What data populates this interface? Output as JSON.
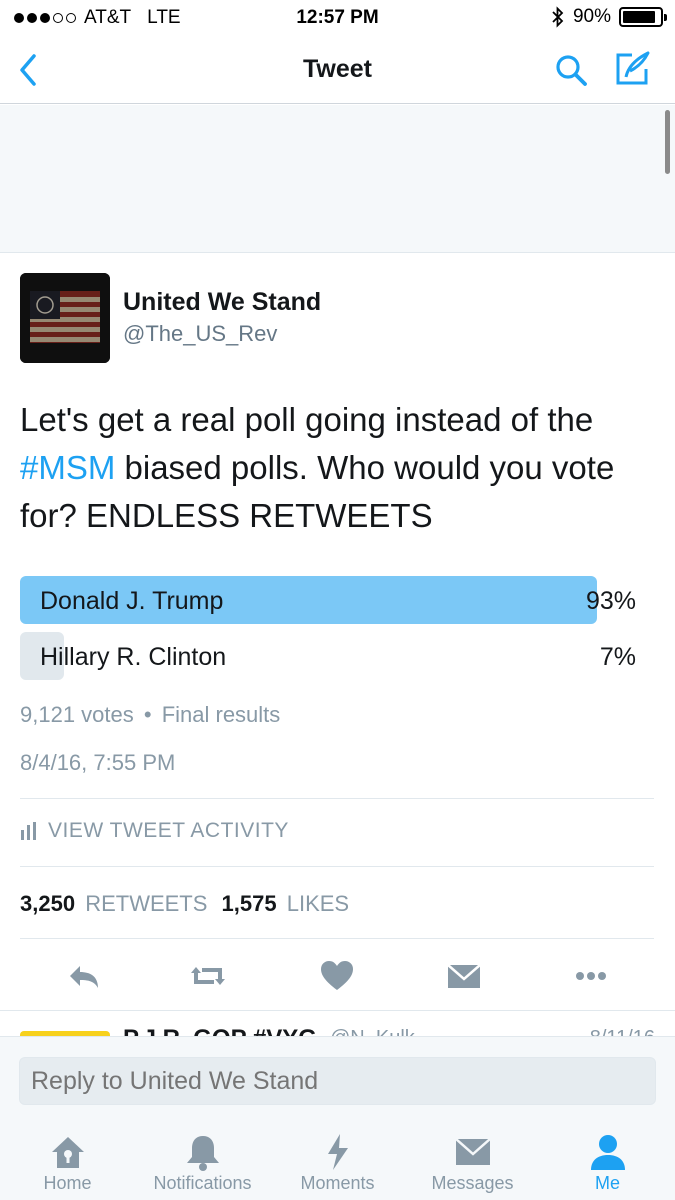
{
  "status_bar": {
    "carrier": "AT&T",
    "network": "LTE",
    "time": "12:57 PM",
    "battery_pct": "90%",
    "battery_level": 0.9
  },
  "nav": {
    "title": "Tweet",
    "back_icon": "chevron-left-icon",
    "search_icon": "search-icon",
    "compose_icon": "compose-icon"
  },
  "tweet": {
    "display_name": "United We Stand",
    "handle": "@The_US_Rev",
    "text_before": "Let's get a real poll going instead of the ",
    "hashtag": "#MSM",
    "text_after": " biased polls. Who would you vote for? ENDLESS RETWEETS",
    "timestamp": "8/4/16, 7:55 PM"
  },
  "poll": {
    "options": [
      {
        "label": "Donald J. Trump",
        "percent_label": "93%",
        "percent": 93,
        "leading": true
      },
      {
        "label": "Hillary R. Clinton",
        "percent_label": "7%",
        "percent": 7,
        "leading": false
      }
    ],
    "votes": "9,121 votes",
    "separator": "•",
    "status": "Final results"
  },
  "activity": {
    "label": "VIEW TWEET ACTIVITY"
  },
  "stats": {
    "retweets_count": "3,250",
    "retweets_label": "RETWEETS",
    "likes_count": "1,575",
    "likes_label": "LIKES"
  },
  "actions": [
    "reply-icon",
    "retweet-icon",
    "like-icon",
    "direct-message-icon",
    "more-icon"
  ],
  "next_tweet": {
    "name": "P.J.R. GOP #VYG",
    "handle": "@N_Kulk",
    "date": "8/11/16"
  },
  "reply": {
    "placeholder": "Reply to United We Stand"
  },
  "tabs": [
    {
      "label": "Home",
      "icon": "home-icon",
      "active": false
    },
    {
      "label": "Notifications",
      "icon": "bell-icon",
      "active": false
    },
    {
      "label": "Moments",
      "icon": "lightning-icon",
      "active": false
    },
    {
      "label": "Messages",
      "icon": "envelope-icon",
      "active": false
    },
    {
      "label": "Me",
      "icon": "person-icon",
      "active": true
    }
  ],
  "colors": {
    "accent": "#1da1f2",
    "poll_leading": "#7bc8f6",
    "poll_other": "#e1e8ed",
    "muted": "#8899a6",
    "text": "#14171a"
  }
}
